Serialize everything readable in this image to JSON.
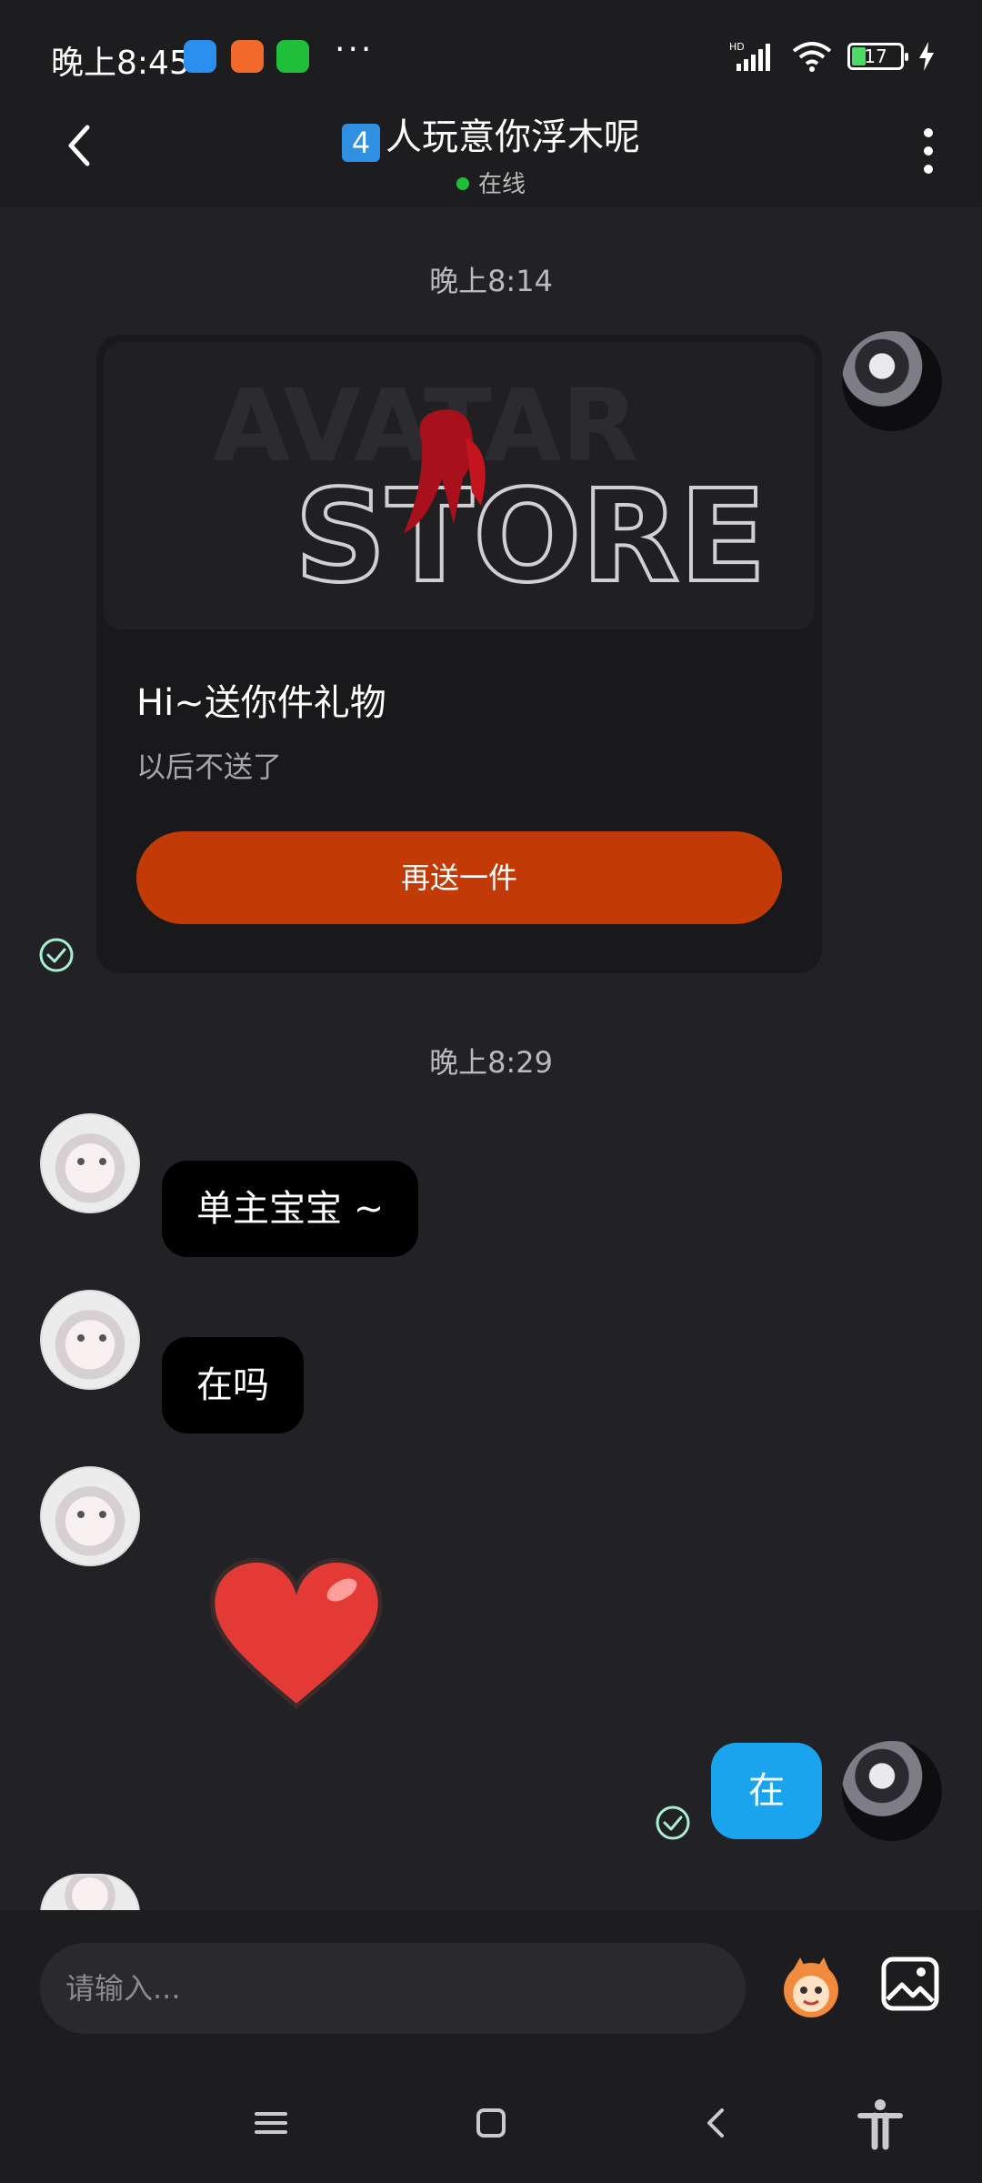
{
  "status_bar": {
    "time": "晚上8:45",
    "more": "···",
    "network": "HD",
    "battery": "17"
  },
  "header": {
    "keycap": "4",
    "title": "人玩意你浮木呢",
    "status": "在线"
  },
  "messages": {
    "time_1": "晚上8:14",
    "gift": {
      "banner_back": "AVATAR",
      "banner_front": "STORE",
      "title": "Hi~送你件礼物",
      "subtitle": "以后不送了",
      "button": "再送一件"
    },
    "time_2": "晚上8:29",
    "msg_1": "单主宝宝 ~",
    "msg_2": "在吗",
    "my_reply": "在"
  },
  "input": {
    "placeholder": "请输入..."
  },
  "icons": {
    "accent_orange": "#c23a05",
    "accent_blue": "#1aa4ee"
  }
}
